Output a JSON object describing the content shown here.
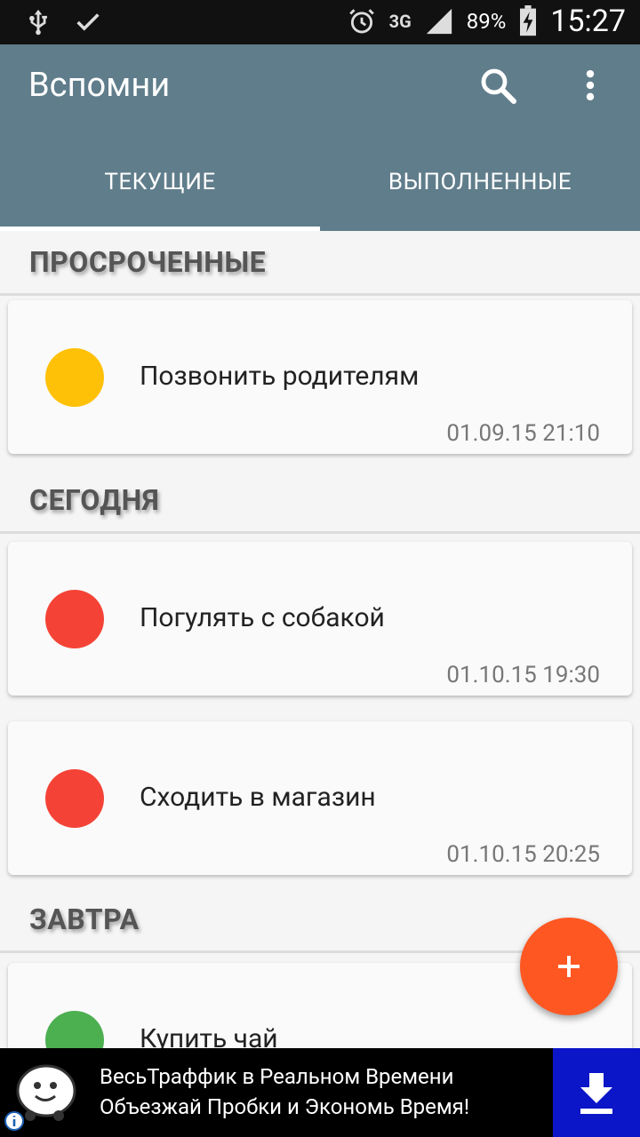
{
  "status_bar": {
    "battery": "89%",
    "time": "15:27",
    "network": "3G"
  },
  "app": {
    "title": "Вспомни",
    "tabs": [
      {
        "label": "ТЕКУЩИЕ",
        "active": true
      },
      {
        "label": "ВЫПОЛНЕННЫЕ",
        "active": false
      }
    ]
  },
  "sections": [
    {
      "title": "ПРОСРОЧЕННЫЕ"
    },
    {
      "title": "СЕГОДНЯ"
    },
    {
      "title": "ЗАВТРА"
    }
  ],
  "reminders": [
    {
      "title": "Позвонить родителям",
      "date": "01.09.15 21:10",
      "color": "#FFC107"
    },
    {
      "title": "Погулять с собакой",
      "date": "01.10.15 19:30",
      "color": "#F44336"
    },
    {
      "title": "Сходить в магазин",
      "date": "01.10.15 20:25",
      "color": "#F44336"
    },
    {
      "title": "Купить чай",
      "date": "",
      "color": "#4CAF50"
    }
  ],
  "fab": {
    "icon": "plus-icon"
  },
  "ad": {
    "line1": "ВесьТраффик в Реальном Времени",
    "line2": "Объезжай Пробки и Экономь Время!"
  }
}
